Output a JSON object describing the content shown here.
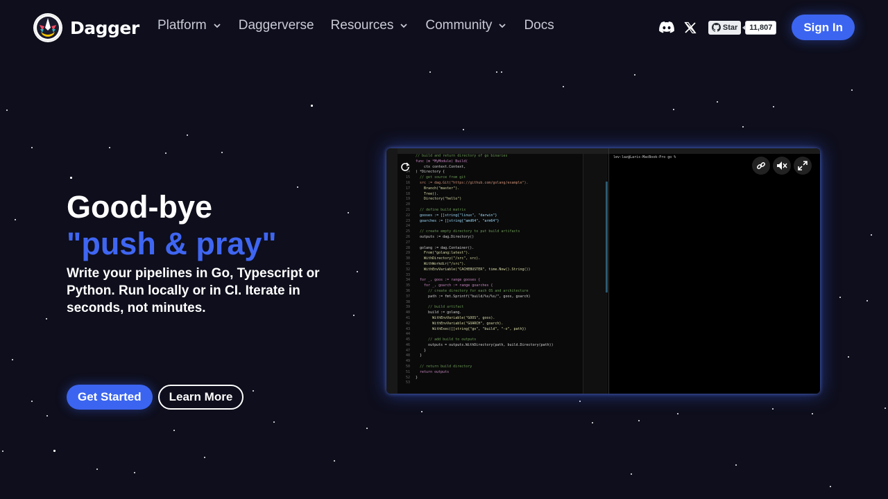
{
  "brand": {
    "name": "Dagger"
  },
  "nav": {
    "items": [
      {
        "label": "Platform",
        "dropdown": true
      },
      {
        "label": "Daggerverse",
        "dropdown": false
      },
      {
        "label": "Resources",
        "dropdown": true
      },
      {
        "label": "Community",
        "dropdown": true
      },
      {
        "label": "Docs",
        "dropdown": false
      }
    ],
    "github": {
      "star_label": "Star",
      "count": "11,807"
    },
    "signin_label": "Sign In"
  },
  "hero": {
    "title_line1": "Good-bye",
    "title_line2": "\"push & pray\"",
    "subtitle": "Write your pipelines in Go, Typescript or Python. Run locally or in CI. Iterate in seconds, not minutes.",
    "primary_cta": "Get Started",
    "secondary_cta": "Learn More"
  },
  "video": {
    "terminal_prompt": "lev-laz@Laris-MacBook-Pro go % ",
    "code": [
      {
        "n": "",
        "t": "// build and return directory of go binaries",
        "c": "cm"
      },
      {
        "n": "",
        "t": "func (m *MyModule) Build(",
        "c": "kw"
      },
      {
        "n": "33",
        "t": "    ctx context.Context,",
        "c": "tx"
      },
      {
        "n": "34",
        "t": ") *Directory {",
        "c": "tx"
      },
      {
        "n": "15",
        "t": "  // get source from git",
        "c": "cm"
      },
      {
        "n": "16",
        "t": "  src := dag.Git(\"https://github.com/golang/example\").",
        "c": "st"
      },
      {
        "n": "17",
        "t": "    Branch(\"master\").",
        "c": "fn"
      },
      {
        "n": "18",
        "t": "    Tree().",
        "c": "fn"
      },
      {
        "n": "19",
        "t": "    Directory(\"hello\")",
        "c": "fn"
      },
      {
        "n": "20",
        "t": "",
        "c": "tx"
      },
      {
        "n": "21",
        "t": "  // define build matrix",
        "c": "cm"
      },
      {
        "n": "22",
        "t": "  gooses := []string{\"linux\", \"darwin\"}",
        "c": "vr"
      },
      {
        "n": "23",
        "t": "  goarches := []string{\"amd64\", \"arm64\"}",
        "c": "vr"
      },
      {
        "n": "24",
        "t": "",
        "c": "tx"
      },
      {
        "n": "25",
        "t": "  // create empty directory to put build artifacts",
        "c": "cm"
      },
      {
        "n": "26",
        "t": "  outputs := dag.Directory()",
        "c": "tx"
      },
      {
        "n": "27",
        "t": "",
        "c": "tx"
      },
      {
        "n": "28",
        "t": "  golang := dag.Container().",
        "c": "tx"
      },
      {
        "n": "29",
        "t": "    From(\"golang:latest\").",
        "c": "fn"
      },
      {
        "n": "30",
        "t": "    WithDirectory(\"/src\", src).",
        "c": "fn"
      },
      {
        "n": "31",
        "t": "    WithWorkdir(\"/src\").",
        "c": "fn"
      },
      {
        "n": "32",
        "t": "    WithEnvVariable(\"CACHEBUSTER\", time.Now().String())",
        "c": "fn"
      },
      {
        "n": "33",
        "t": "",
        "c": "tx"
      },
      {
        "n": "34",
        "t": "  for _, goos := range gooses {",
        "c": "kw"
      },
      {
        "n": "35",
        "t": "    for _, goarch := range goarches {",
        "c": "kw"
      },
      {
        "n": "36",
        "t": "      // create directory for each OS and architecture",
        "c": "cm"
      },
      {
        "n": "37",
        "t": "      path := fmt.Sprintf(\"build/%s/%s/\", goos, goarch)",
        "c": "tx"
      },
      {
        "n": "38",
        "t": "",
        "c": "tx"
      },
      {
        "n": "39",
        "t": "      // build artifact",
        "c": "cm"
      },
      {
        "n": "40",
        "t": "      build := golang.",
        "c": "tx"
      },
      {
        "n": "41",
        "t": "        WithEnvVariable(\"GOOS\", goos).",
        "c": "fn"
      },
      {
        "n": "42",
        "t": "        WithEnvVariable(\"GOARCH\", goarch).",
        "c": "fn"
      },
      {
        "n": "43",
        "t": "        WithExec([]string{\"go\", \"build\", \"-o\", path})",
        "c": "fn"
      },
      {
        "n": "44",
        "t": "",
        "c": "tx"
      },
      {
        "n": "45",
        "t": "      // add build to outputs",
        "c": "cm"
      },
      {
        "n": "46",
        "t": "      outputs = outputs.WithDirectory(path, build.Directory(path))",
        "c": "tx"
      },
      {
        "n": "47",
        "t": "    }",
        "c": "tx"
      },
      {
        "n": "48",
        "t": "  }",
        "c": "tx"
      },
      {
        "n": "49",
        "t": "",
        "c": "tx"
      },
      {
        "n": "50",
        "t": "  // return build directory",
        "c": "cm"
      },
      {
        "n": "51",
        "t": "  return outputs",
        "c": "kw"
      },
      {
        "n": "52",
        "t": "}",
        "c": "tx"
      },
      {
        "n": "53",
        "t": "",
        "c": "tx"
      }
    ]
  }
}
